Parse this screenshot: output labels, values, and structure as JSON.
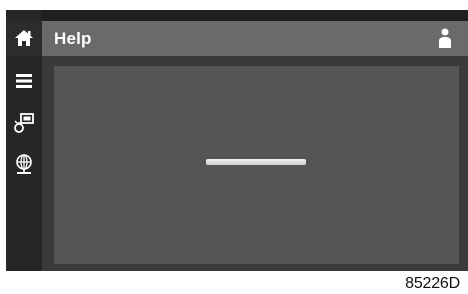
{
  "header": {
    "title": "Help"
  },
  "sidebar": {
    "items": [
      {
        "icon": "home-icon"
      },
      {
        "icon": "menu-icon"
      },
      {
        "icon": "display-settings-icon"
      },
      {
        "icon": "network-globe-icon"
      }
    ]
  },
  "content": {
    "loading_progress": 1.0
  },
  "figure_label": "85226D",
  "colors": {
    "title_bar": "#6a6a6a",
    "sidebar": "#262626",
    "content_panel": "#555555",
    "icon": "#ffffff"
  }
}
